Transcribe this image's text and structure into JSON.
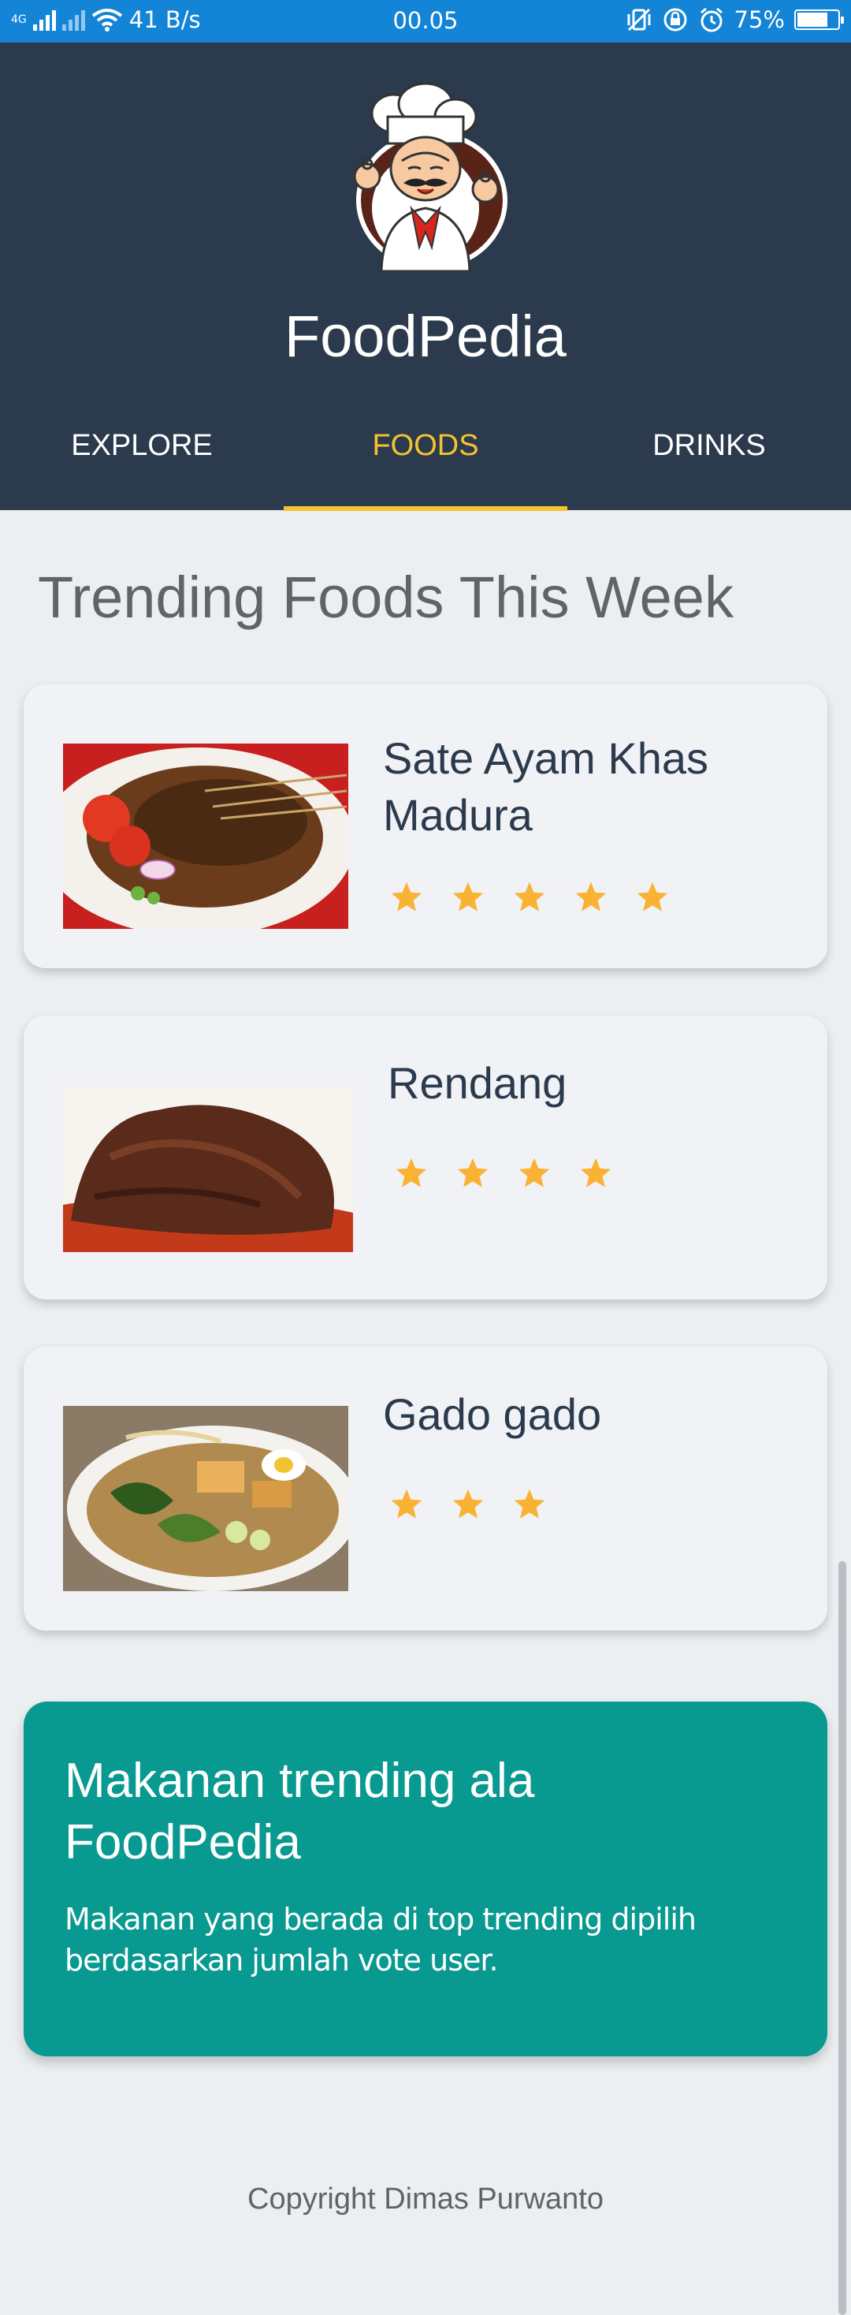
{
  "status_bar": {
    "network": "4G",
    "speed": "41 B/s",
    "time": "00.05",
    "battery": "75%",
    "battery_level": 0.75
  },
  "header": {
    "app_title": "FoodPedia",
    "logo": "chef-logo",
    "tabs": [
      {
        "label": "EXPLORE",
        "active": false
      },
      {
        "label": "FOODS",
        "active": true
      },
      {
        "label": "DRINKS",
        "active": false
      }
    ]
  },
  "main": {
    "section_title": "Trending Foods This Week",
    "foods": [
      {
        "name": "Sate Ayam Khas Madura",
        "rating": 5,
        "image": "sate-image"
      },
      {
        "name": "Rendang",
        "rating": 4,
        "image": "rendang-image"
      },
      {
        "name": "Gado gado",
        "rating": 3,
        "image": "gado-gado-image"
      }
    ],
    "promo": {
      "title": "Makanan trending ala FoodPedia",
      "text": "Makanan yang berada di top trending dipilih berdasarkan jumlah vote user."
    },
    "copyright": "Copyright Dimas Purwanto"
  },
  "colors": {
    "header_bg": "#2c3a4d",
    "accent": "#f4c430",
    "promo_bg": "#089990",
    "status_bar": "#1384d6",
    "star": "#f9b233"
  }
}
